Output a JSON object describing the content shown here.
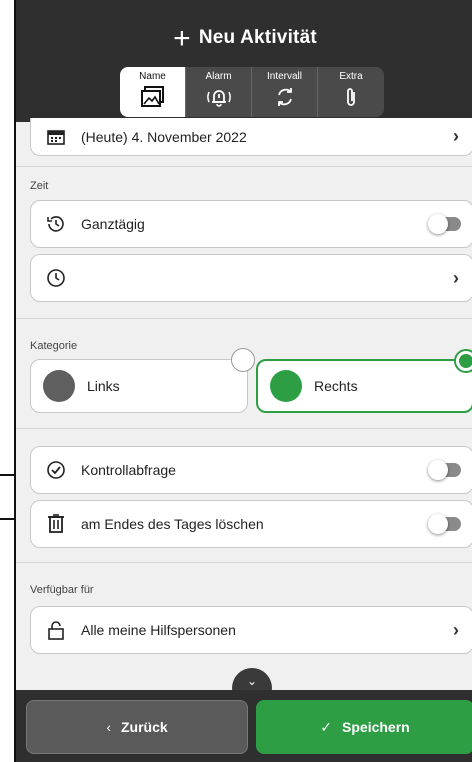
{
  "header": {
    "title": "Neu Aktivität",
    "tabs": [
      {
        "label": "Name",
        "icon": "image-icon",
        "active": true
      },
      {
        "label": "Alarm",
        "icon": "alarm-bell-icon",
        "active": false
      },
      {
        "label": "Intervall",
        "icon": "repeat-icon",
        "active": false
      },
      {
        "label": "Extra",
        "icon": "paperclip-icon",
        "active": false
      }
    ]
  },
  "date": {
    "value": "(Heute) 4. November 2022"
  },
  "time": {
    "section_label": "Zeit",
    "all_day_label": "Ganztägig",
    "all_day_on": false,
    "time_value": ""
  },
  "category": {
    "section_label": "Kategorie",
    "left": {
      "label": "Links",
      "color": "#5f5f5f",
      "selected": false
    },
    "right": {
      "label": "Rechts",
      "color": "#2e9e45",
      "selected": true
    }
  },
  "options": {
    "check_label": "Kontrollabfrage",
    "check_on": false,
    "delete_label": "am Endes des Tages löschen",
    "delete_on": false
  },
  "availability": {
    "section_label": "Verfügbar für",
    "value": "Alle meine Hilfspersonen"
  },
  "footer": {
    "back_label": "Zurück",
    "save_label": "Speichern"
  },
  "colors": {
    "accent": "#2e9e45",
    "header_bg": "#2f2f2f"
  }
}
